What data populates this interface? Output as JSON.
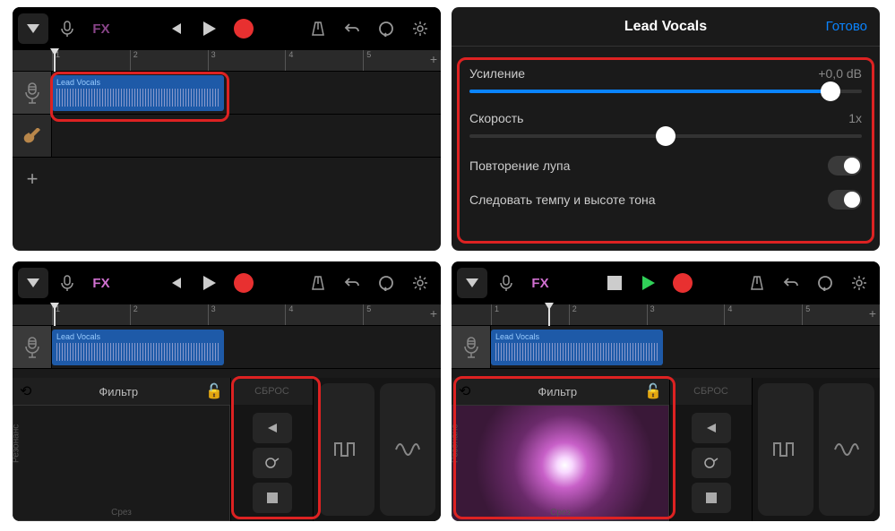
{
  "toolbar": {
    "fx": "FX"
  },
  "timeline": {
    "marks": [
      "1",
      "2",
      "3",
      "4",
      "5"
    ],
    "add": "+"
  },
  "region": {
    "name": "Lead Vocals"
  },
  "addTrack": "+",
  "settings": {
    "title": "Lead Vocals",
    "done": "Готово",
    "gain": {
      "label": "Усиление",
      "value": "+0,0 dB"
    },
    "speed": {
      "label": "Скорость",
      "value": "1x"
    },
    "loopRepeat": "Повторение лупа",
    "followTempo": "Следовать темпу и высоте тона"
  },
  "fx": {
    "filter": "Фильтр",
    "reset": "СБРОС",
    "xlabel": "Срез",
    "ylabel": "Резонанс"
  }
}
